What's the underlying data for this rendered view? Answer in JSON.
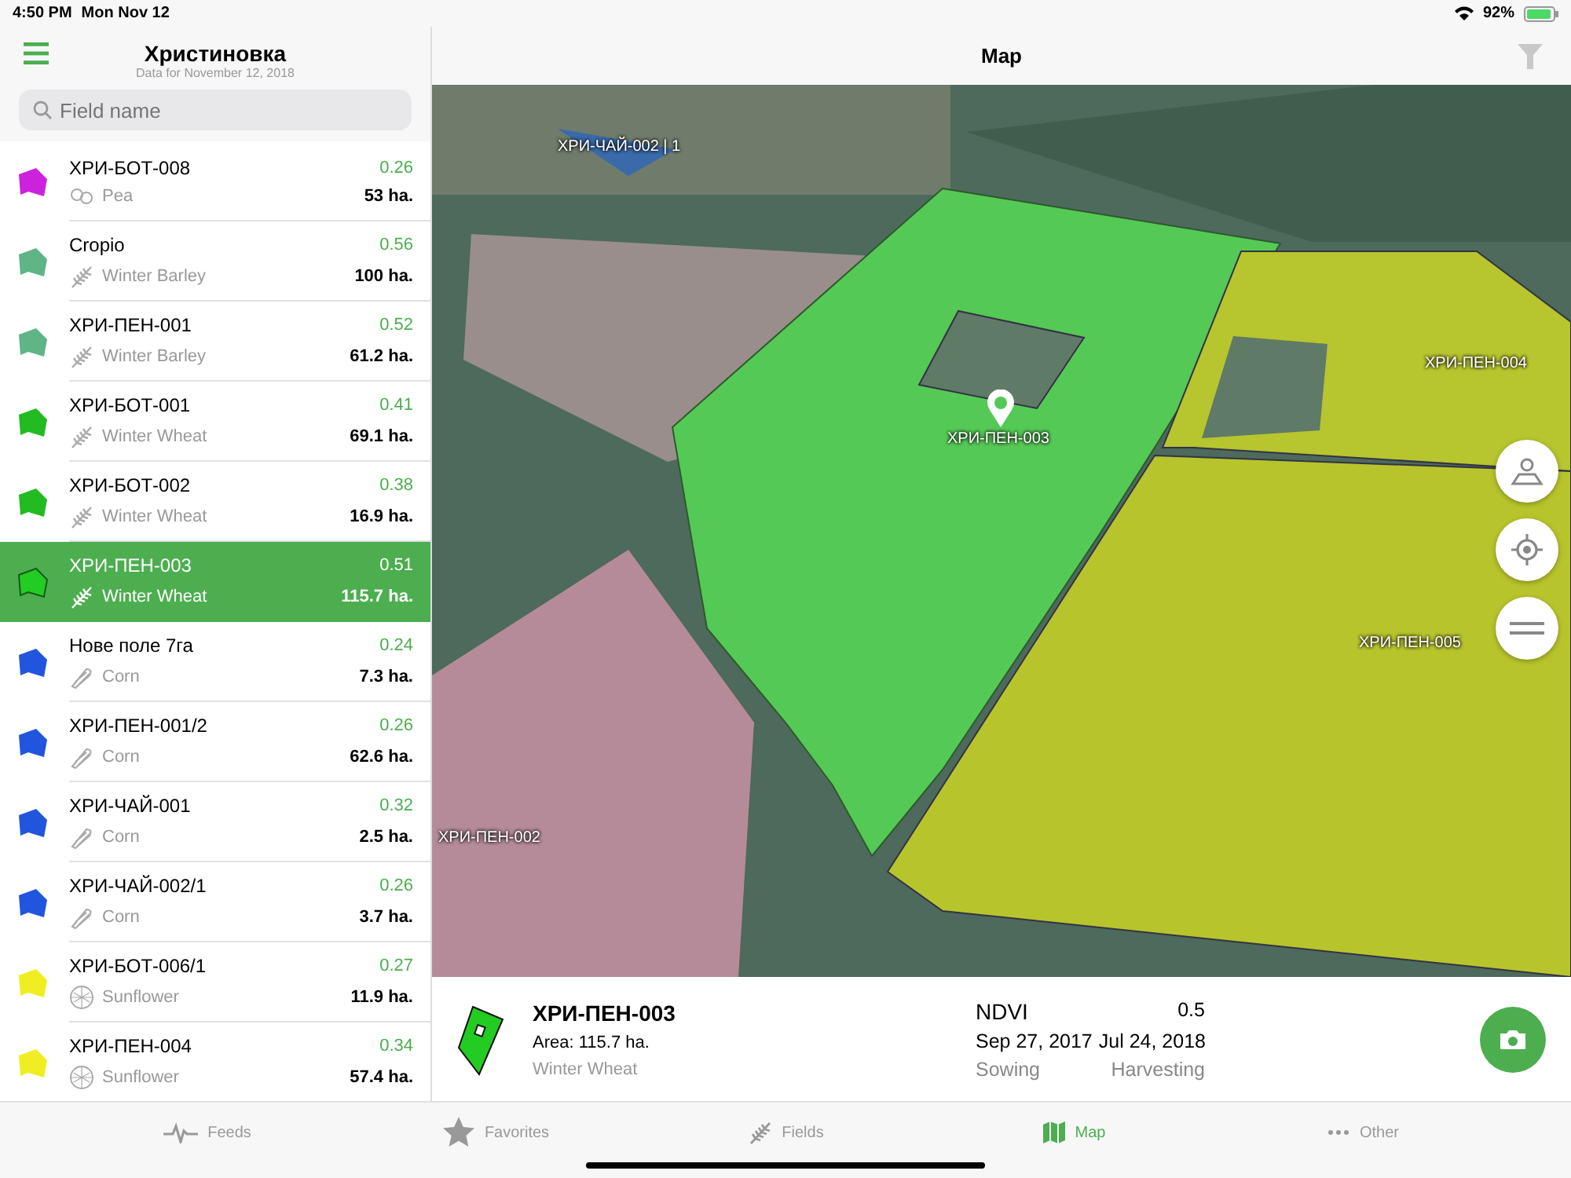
{
  "status_bar": {
    "time": "4:50 PM",
    "date": "Mon Nov 12",
    "battery": "92%"
  },
  "sidebar": {
    "title": "Христиновка",
    "subtitle": "Data for November 12, 2018",
    "search": {
      "placeholder": "Field name"
    },
    "fields": [
      {
        "name": "ХРИ-БОТ-008",
        "crop": "Pea",
        "kind": "pea",
        "ndvi": "0.26",
        "area": "53 ha.",
        "color": "#cc22dd",
        "selected": false
      },
      {
        "name": "Cropio",
        "crop": "Winter Barley",
        "kind": "cereal",
        "ndvi": "0.56",
        "area": "100 ha.",
        "color": "#5fb585",
        "selected": false
      },
      {
        "name": "ХРИ-ПЕН-001",
        "crop": "Winter Barley",
        "kind": "cereal",
        "ndvi": "0.52",
        "area": "61.2 ha.",
        "color": "#5fb585",
        "selected": false
      },
      {
        "name": "ХРИ-БОТ-001",
        "crop": "Winter Wheat",
        "kind": "cereal",
        "ndvi": "0.41",
        "area": "69.1 ha.",
        "color": "#22bb22",
        "selected": false
      },
      {
        "name": "ХРИ-БОТ-002",
        "crop": "Winter Wheat",
        "kind": "cereal",
        "ndvi": "0.38",
        "area": "16.9 ha.",
        "color": "#22bb22",
        "selected": false
      },
      {
        "name": "ХРИ-ПЕН-003",
        "crop": "Winter Wheat",
        "kind": "cereal",
        "ndvi": "0.51",
        "area": "115.7 ha.",
        "color": "#22cc22",
        "selected": true
      },
      {
        "name": "Нове поле 7га",
        "crop": "Corn",
        "kind": "corn",
        "ndvi": "0.24",
        "area": "7.3 ha.",
        "color": "#2255dd",
        "selected": false
      },
      {
        "name": "ХРИ-ПЕН-001/2",
        "crop": "Corn",
        "kind": "corn",
        "ndvi": "0.26",
        "area": "62.6 ha.",
        "color": "#2255dd",
        "selected": false
      },
      {
        "name": "ХРИ-ЧАЙ-001",
        "crop": "Corn",
        "kind": "corn",
        "ndvi": "0.32",
        "area": "2.5 ha.",
        "color": "#2255dd",
        "selected": false
      },
      {
        "name": "ХРИ-ЧАЙ-002/1",
        "crop": "Corn",
        "kind": "corn",
        "ndvi": "0.26",
        "area": "3.7 ha.",
        "color": "#2255dd",
        "selected": false
      },
      {
        "name": "ХРИ-БОТ-006/1",
        "crop": "Sunflower",
        "kind": "sunflower",
        "ndvi": "0.27",
        "area": "11.9 ha.",
        "color": "#eeee22",
        "selected": false
      },
      {
        "name": "ХРИ-ПЕН-004",
        "crop": "Sunflower",
        "kind": "sunflower",
        "ndvi": "0.34",
        "area": "57.4 ha.",
        "color": "#eeee22",
        "selected": false
      }
    ]
  },
  "map": {
    "title": "Map",
    "labels": [
      "ХРИ-ЧАЙ-002 | 1",
      "ХРИ-ПЕН-004",
      "ХРИ-ПЕН-003",
      "ХРИ-ПЕН-005",
      "ХРИ-ПЕН-002"
    ]
  },
  "field_card": {
    "name": "ХРИ-ПЕН-003",
    "area": "Area: 115.7 ha.",
    "crop": "Winter Wheat",
    "ndvi_label": "NDVI",
    "ndvi_value": "0.5",
    "sowing_date": "Sep 27, 2017",
    "harvest_date": "Jul 24, 2018",
    "sowing_label": "Sowing",
    "harvest_label": "Harvesting"
  },
  "tabs": [
    {
      "label": "Feeds",
      "kind": "feeds",
      "selected": false
    },
    {
      "label": "Favorites",
      "kind": "favorites",
      "selected": false
    },
    {
      "label": "Fields",
      "kind": "fields",
      "selected": false
    },
    {
      "label": "Map",
      "kind": "map",
      "selected": true
    },
    {
      "label": "Other",
      "kind": "other",
      "selected": false
    }
  ]
}
